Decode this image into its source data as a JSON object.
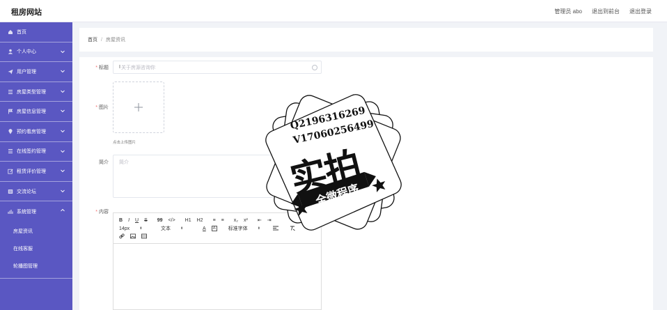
{
  "header": {
    "logo": "租房网站",
    "admin_label": "管理员 abo",
    "to_front": "退出到前台",
    "logout": "退出登录"
  },
  "sidebar": {
    "items": [
      {
        "label": "首页",
        "icon": "home-icon",
        "has_chevron": false
      },
      {
        "label": "个人中心",
        "icon": "user-icon",
        "has_chevron": true
      },
      {
        "label": "用户管理",
        "icon": "send-icon",
        "has_chevron": true
      },
      {
        "label": "房屋类型管理",
        "icon": "list-icon",
        "has_chevron": true
      },
      {
        "label": "房屋信息管理",
        "icon": "flag-icon",
        "has_chevron": true
      },
      {
        "label": "预约看房管理",
        "icon": "location-icon",
        "has_chevron": true
      },
      {
        "label": "在线签约管理",
        "icon": "list-icon",
        "has_chevron": true
      },
      {
        "label": "租赁评价管理",
        "icon": "edit-icon",
        "has_chevron": true
      },
      {
        "label": "交流论坛",
        "icon": "forum-icon",
        "has_chevron": true
      },
      {
        "label": "系统管理",
        "icon": "chart-icon",
        "has_chevron": true,
        "expanded": true
      }
    ],
    "sub_items": [
      "房屋资讯",
      "在线客服",
      "轮播图管理"
    ]
  },
  "breadcrumb": {
    "home": "首页",
    "separator": "/",
    "current": "房屋资讯"
  },
  "form": {
    "title_label": "标题",
    "title_value": "关于房源咨询你",
    "image_label": "图片",
    "upload_tip": "点击上传图片",
    "intro_label": "简介",
    "intro_placeholder": "简介",
    "content_label": "内容"
  },
  "editor": {
    "font_size": "14px",
    "text_type": "文本",
    "font_family": "标准字体",
    "toolbar_row1": [
      "B",
      "I",
      "U",
      "S",
      "99",
      "</>",
      "H1",
      "H2",
      "≡",
      "≡",
      "x₂",
      "x²",
      "⇤",
      "⇥"
    ]
  },
  "watermark": {
    "line1": "Q2196316269",
    "line2": "V17060256499",
    "big": "实拍",
    "banner": "全微程序"
  },
  "colors": {
    "sidebar_bg": "#5a57c2",
    "required": "#f56c6c",
    "page_bg": "#f1f3f7"
  }
}
